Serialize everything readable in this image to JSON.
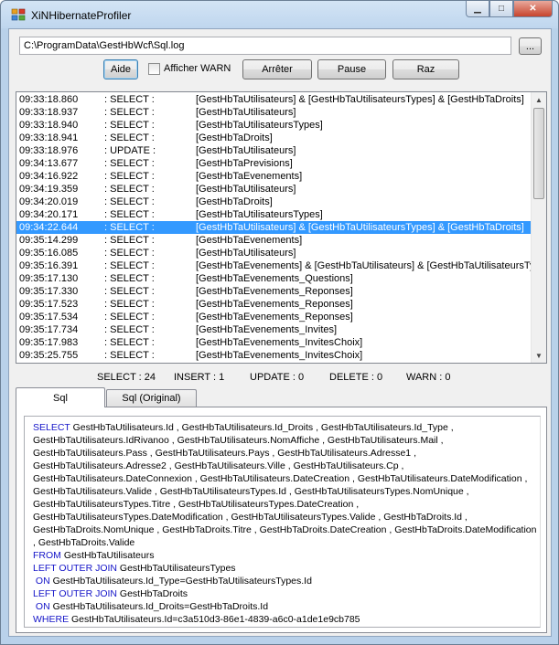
{
  "window": {
    "title": "XiNHibernateProfiler"
  },
  "toolbar": {
    "path_value": "C:\\ProgramData\\GestHbWcf\\Sql.log",
    "browse_label": "...",
    "aide_label": "Aide",
    "warn_label": "Afficher WARN",
    "warn_checked": false,
    "arreter_label": "Arrêter",
    "pause_label": "Pause",
    "raz_label": "Raz"
  },
  "log": {
    "selected_index": 10,
    "rows": [
      {
        "time": "09:33:18.860",
        "op": ": SELECT :",
        "tables": "[GestHbTaUtilisateurs] & [GestHbTaUtilisateursTypes] & [GestHbTaDroits]"
      },
      {
        "time": "09:33:18.937",
        "op": ": SELECT :",
        "tables": "[GestHbTaUtilisateurs]"
      },
      {
        "time": "09:33:18.940",
        "op": ": SELECT :",
        "tables": "[GestHbTaUtilisateursTypes]"
      },
      {
        "time": "09:33:18.941",
        "op": ": SELECT :",
        "tables": "[GestHbTaDroits]"
      },
      {
        "time": "09:33:18.976",
        "op": ": UPDATE :",
        "tables": "[GestHbTaUtilisateurs]"
      },
      {
        "time": "09:34:13.677",
        "op": ": SELECT :",
        "tables": "[GestHbTaPrevisions]"
      },
      {
        "time": "09:34:16.922",
        "op": ": SELECT :",
        "tables": "[GestHbTaEvenements]"
      },
      {
        "time": "09:34:19.359",
        "op": ": SELECT :",
        "tables": "[GestHbTaUtilisateurs]"
      },
      {
        "time": "09:34:20.019",
        "op": ": SELECT :",
        "tables": "[GestHbTaDroits]"
      },
      {
        "time": "09:34:20.171",
        "op": ": SELECT :",
        "tables": "[GestHbTaUtilisateursTypes]"
      },
      {
        "time": "09:34:22.644",
        "op": ": SELECT :",
        "tables": "[GestHbTaUtilisateurs] & [GestHbTaUtilisateursTypes] & [GestHbTaDroits]"
      },
      {
        "time": "09:35:14.299",
        "op": ": SELECT :",
        "tables": "[GestHbTaEvenements]"
      },
      {
        "time": "09:35:16.085",
        "op": ": SELECT :",
        "tables": "[GestHbTaUtilisateurs]"
      },
      {
        "time": "09:35:16.391",
        "op": ": SELECT :",
        "tables": "[GestHbTaEvenements] & [GestHbTaUtilisateurs] & [GestHbTaUtilisateursTypes]"
      },
      {
        "time": "09:35:17.130",
        "op": ": SELECT :",
        "tables": "[GestHbTaEvenements_Questions]"
      },
      {
        "time": "09:35:17.330",
        "op": ": SELECT :",
        "tables": "[GestHbTaEvenements_Reponses]"
      },
      {
        "time": "09:35:17.523",
        "op": ": SELECT :",
        "tables": "[GestHbTaEvenements_Reponses]"
      },
      {
        "time": "09:35:17.534",
        "op": ": SELECT :",
        "tables": "[GestHbTaEvenements_Reponses]"
      },
      {
        "time": "09:35:17.734",
        "op": ": SELECT :",
        "tables": "[GestHbTaEvenements_Invites]"
      },
      {
        "time": "09:35:17.983",
        "op": ": SELECT :",
        "tables": "[GestHbTaEvenements_InvitesChoix]"
      },
      {
        "time": "09:35:25.755",
        "op": ": SELECT :",
        "tables": "[GestHbTaEvenements_InvitesChoix]"
      }
    ]
  },
  "stats": {
    "select": "SELECT : 24",
    "insert": "INSERT : 1",
    "update": "UPDATE : 0",
    "delete": "DELETE : 0",
    "warn": "WARN : 0"
  },
  "tabs": {
    "sql": "Sql",
    "sql_original": "Sql (Original)"
  },
  "sql_view": {
    "lines": [
      [
        {
          "kw": true,
          "t": "SELECT"
        },
        {
          "t": " GestHbTaUtilisateurs.Id , GestHbTaUtilisateurs.Id_Droits , GestHbTaUtilisateurs.Id_Type ,"
        }
      ],
      [
        {
          "t": "GestHbTaUtilisateurs.IdRivanoo , GestHbTaUtilisateurs.NomAffiche , GestHbTaUtilisateurs.Mail ,"
        }
      ],
      [
        {
          "t": "GestHbTaUtilisateurs.Pass , GestHbTaUtilisateurs.Pays , GestHbTaUtilisateurs.Adresse1 ,"
        }
      ],
      [
        {
          "t": "GestHbTaUtilisateurs.Adresse2 , GestHbTaUtilisateurs.Ville , GestHbTaUtilisateurs.Cp ,"
        }
      ],
      [
        {
          "t": "GestHbTaUtilisateurs.DateConnexion , GestHbTaUtilisateurs.DateCreation , GestHbTaUtilisateurs.DateModification ,"
        }
      ],
      [
        {
          "t": "GestHbTaUtilisateurs.Valide , GestHbTaUtilisateursTypes.Id , GestHbTaUtilisateursTypes.NomUnique ,"
        }
      ],
      [
        {
          "t": "GestHbTaUtilisateursTypes.Titre , GestHbTaUtilisateursTypes.DateCreation ,"
        }
      ],
      [
        {
          "t": "GestHbTaUtilisateursTypes.DateModification , GestHbTaUtilisateursTypes.Valide , GestHbTaDroits.Id ,"
        }
      ],
      [
        {
          "t": "GestHbTaDroits.NomUnique , GestHbTaDroits.Titre , GestHbTaDroits.DateCreation , GestHbTaDroits.DateModification"
        }
      ],
      [
        {
          "t": ", GestHbTaDroits.Valide"
        }
      ],
      [
        {
          "kw": true,
          "t": "FROM"
        },
        {
          "t": " GestHbTaUtilisateurs"
        }
      ],
      [
        {
          "kw": true,
          "t": "LEFT OUTER JOIN"
        },
        {
          "t": " GestHbTaUtilisateursTypes"
        }
      ],
      [
        {
          "kw": true,
          "t": " ON"
        },
        {
          "t": " GestHbTaUtilisateurs.Id_Type=GestHbTaUtilisateursTypes.Id"
        }
      ],
      [
        {
          "kw": true,
          "t": "LEFT OUTER JOIN"
        },
        {
          "t": " GestHbTaDroits"
        }
      ],
      [
        {
          "kw": true,
          "t": " ON"
        },
        {
          "t": " GestHbTaUtilisateurs.Id_Droits=GestHbTaDroits.Id"
        }
      ],
      [
        {
          "kw": true,
          "t": "WHERE"
        },
        {
          "t": " GestHbTaUtilisateurs.Id=c3a510d3-86e1-4839-a6c0-a1de1e9cb785"
        }
      ]
    ]
  }
}
